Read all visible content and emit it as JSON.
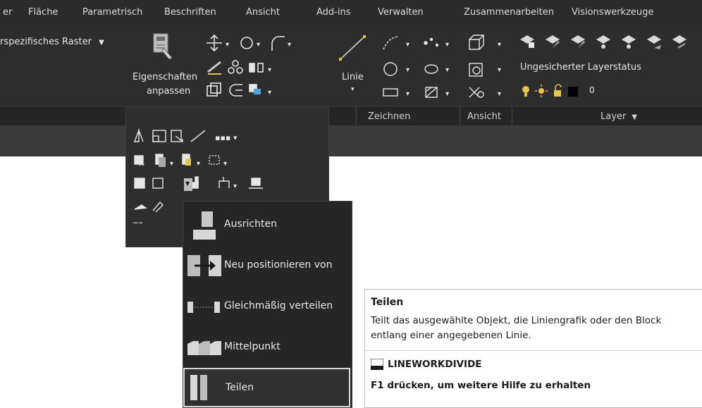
{
  "tabs": [
    "er",
    "Fläche",
    "Parametrisch",
    "Beschriften",
    "Ansicht",
    "Add-ins",
    "Verwalten",
    "Zusammenarbeiten",
    "Visionswerkzeuge"
  ],
  "ribbon": {
    "grid_dropdown": "rspezifisches Raster",
    "eigenschaften_l1": "Eigenschaften",
    "eigenschaften_l2": "anpassen",
    "linie": "Linie",
    "layer_status": "Ungesicherter Layerstatus",
    "layer_value": "0",
    "groups": {
      "zeichnen": "Zeichnen",
      "ansicht": "Ansicht",
      "layer": "Layer"
    }
  },
  "dropdown": {
    "items": [
      "Ausrichten",
      "Neu positionieren von",
      "Gleichmäßig verteilen",
      "Mittelpunkt",
      "Teilen"
    ]
  },
  "tooltip": {
    "title": "Teilen",
    "line1": "Teilt das ausgewählte Objekt, die Liniengrafik oder den Block",
    "line2": "entlang einer angegebenen Linie.",
    "command": "LINEWORKDIVIDE",
    "help": "F1 drücken, um weitere Hilfe zu erhalten"
  },
  "colors": {
    "menubar": "#2b2b2b",
    "ribbon": "#2d2d2d",
    "dropdown": "#262626",
    "tooltip": "#ffffff"
  }
}
